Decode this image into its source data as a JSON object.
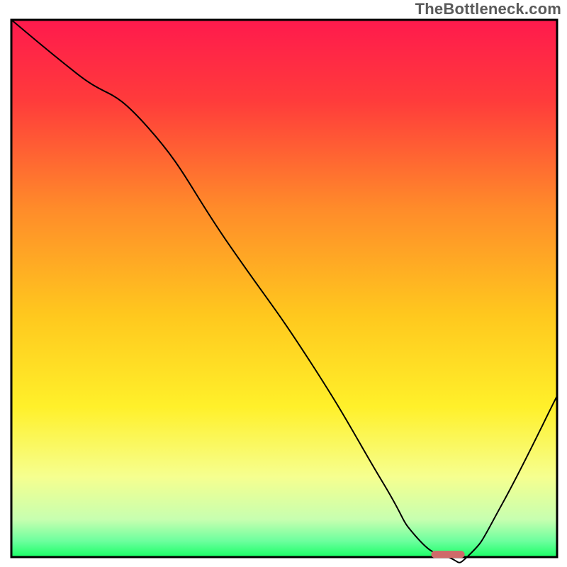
{
  "watermark": "TheBottleneck.com",
  "chart_data": {
    "type": "line",
    "title": "",
    "xlabel": "",
    "ylabel": "",
    "xlim": [
      0,
      100
    ],
    "ylim": [
      0,
      100
    ],
    "series": [
      {
        "name": "curve",
        "x": [
          0,
          12,
          25,
          40,
          55,
          68,
          74,
          80,
          84,
          90,
          100
        ],
        "values": [
          100,
          90,
          80,
          58,
          36,
          14,
          4,
          0,
          0.5,
          10,
          30
        ]
      }
    ],
    "marker": {
      "x": 80,
      "y": 0.5,
      "width": 6,
      "height": 1.2
    },
    "gradient_stops": [
      {
        "offset": 0.0,
        "color": "#ff1a4d"
      },
      {
        "offset": 0.15,
        "color": "#ff3b3b"
      },
      {
        "offset": 0.35,
        "color": "#ff8b2a"
      },
      {
        "offset": 0.55,
        "color": "#ffc81e"
      },
      {
        "offset": 0.72,
        "color": "#fff02a"
      },
      {
        "offset": 0.85,
        "color": "#f6ff8f"
      },
      {
        "offset": 0.93,
        "color": "#c7ffb0"
      },
      {
        "offset": 0.97,
        "color": "#6dff9e"
      },
      {
        "offset": 1.0,
        "color": "#1aff66"
      }
    ]
  },
  "geom": {
    "outer_w": 800,
    "outer_h": 800,
    "inner_x": 16,
    "inner_y": 28,
    "inner_w": 770,
    "inner_h": 758
  }
}
